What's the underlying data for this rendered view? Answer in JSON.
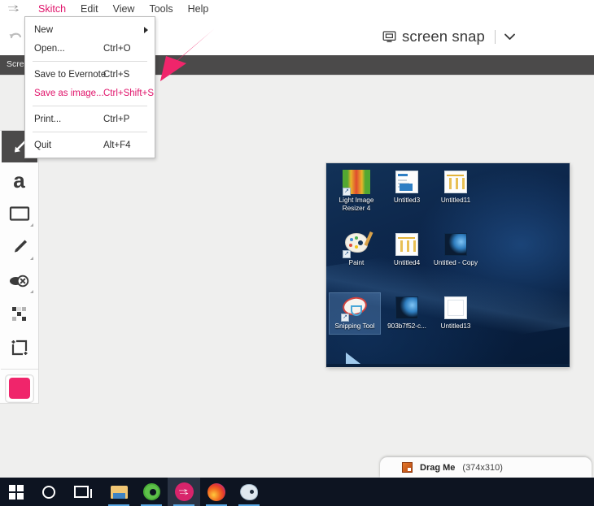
{
  "app": {
    "logo_icon": "skitch-arrow-logo",
    "menus": [
      {
        "label": "Skitch",
        "active": true
      },
      {
        "label": "Edit",
        "active": false
      },
      {
        "label": "View",
        "active": false
      },
      {
        "label": "Tools",
        "active": false
      },
      {
        "label": "Help",
        "active": false
      }
    ]
  },
  "toolbar": {
    "undo_icon": "undo-icon",
    "snap_title": "screen snap",
    "snap_monitor_icon": "monitor-icon",
    "snap_chevron_icon": "chevron-down-icon"
  },
  "tabbar": {
    "tab_label": "Scree"
  },
  "file_menu": {
    "items": [
      {
        "label": "New",
        "accel": "",
        "highlight": false,
        "submenu": true
      },
      {
        "label": "Open...",
        "accel": "Ctrl+O",
        "highlight": false,
        "submenu": false
      },
      {
        "separator": true
      },
      {
        "label": "Save to Evernote",
        "accel": "Ctrl+S",
        "highlight": false,
        "submenu": false
      },
      {
        "label": "Save as image...",
        "accel": "Ctrl+Shift+S",
        "highlight": true,
        "submenu": false
      },
      {
        "separator": true
      },
      {
        "label": "Print...",
        "accel": "Ctrl+P",
        "highlight": false,
        "submenu": false
      },
      {
        "separator": true
      },
      {
        "label": "Quit",
        "accel": "Alt+F4",
        "highlight": false,
        "submenu": false
      }
    ]
  },
  "palette": {
    "tools": [
      {
        "name": "arrow-tool",
        "icon": "arrow-icon",
        "selected": true
      },
      {
        "name": "text-tool",
        "icon": "letter-a-icon",
        "selected": false
      },
      {
        "name": "shape-tool",
        "icon": "rectangle-icon",
        "selected": false
      },
      {
        "name": "marker-tool",
        "icon": "pen-icon",
        "selected": false
      },
      {
        "name": "blur-tool",
        "icon": "stamp-icon",
        "selected": false
      },
      {
        "name": "pixelate-tool",
        "icon": "pixelate-icon",
        "selected": false
      },
      {
        "name": "crop-tool",
        "icon": "crop-icon",
        "selected": false
      }
    ],
    "color_swatch": "#F0256B"
  },
  "annotation": {
    "type": "arrow",
    "color": "#F0256B"
  },
  "screenshot": {
    "desktop_icons": [
      {
        "label": "Light Image Resizer 4",
        "art": "lir",
        "selected": false
      },
      {
        "label": "Untitled3",
        "art": "doc",
        "selected": false
      },
      {
        "label": "Untitled11",
        "art": "doc2",
        "selected": false
      },
      {
        "label": "Paint",
        "art": "pal",
        "selected": false
      },
      {
        "label": "Untitled4",
        "art": "doc2",
        "selected": false
      },
      {
        "label": "Untitled - Copy",
        "art": "win",
        "selected": false
      },
      {
        "label": "Snipping Tool",
        "art": "snip",
        "selected": true
      },
      {
        "label": "903b7f52-c...",
        "art": "win",
        "selected": false
      },
      {
        "label": "Untitled13",
        "art": "doc3",
        "selected": false
      }
    ]
  },
  "drag_me": {
    "icon": "image-file-icon",
    "label": "Drag Me",
    "dimensions": "(374x310)"
  },
  "taskbar": {
    "items": [
      {
        "name": "start-button",
        "icon": "windows-logo-icon",
        "active": false,
        "running": false
      },
      {
        "name": "cortana-button",
        "icon": "circle-icon",
        "active": false,
        "running": false
      },
      {
        "name": "task-view-button",
        "icon": "task-view-icon",
        "active": false,
        "running": false
      },
      {
        "name": "file-explorer-button",
        "icon": "folder-icon",
        "active": false,
        "running": true
      },
      {
        "name": "green-app-button",
        "icon": "green-circle-icon",
        "active": false,
        "running": true
      },
      {
        "name": "skitch-button",
        "icon": "skitch-icon",
        "active": true,
        "running": true
      },
      {
        "name": "firefox-button",
        "icon": "firefox-icon",
        "active": false,
        "running": true
      },
      {
        "name": "paint-button",
        "icon": "paint-icon",
        "active": false,
        "running": true
      }
    ]
  },
  "colors": {
    "accent_pink": "#E0136A",
    "dark_bar": "#4B4A4A",
    "canvas": "#EFEFEE",
    "taskbar": "#0D1421"
  }
}
